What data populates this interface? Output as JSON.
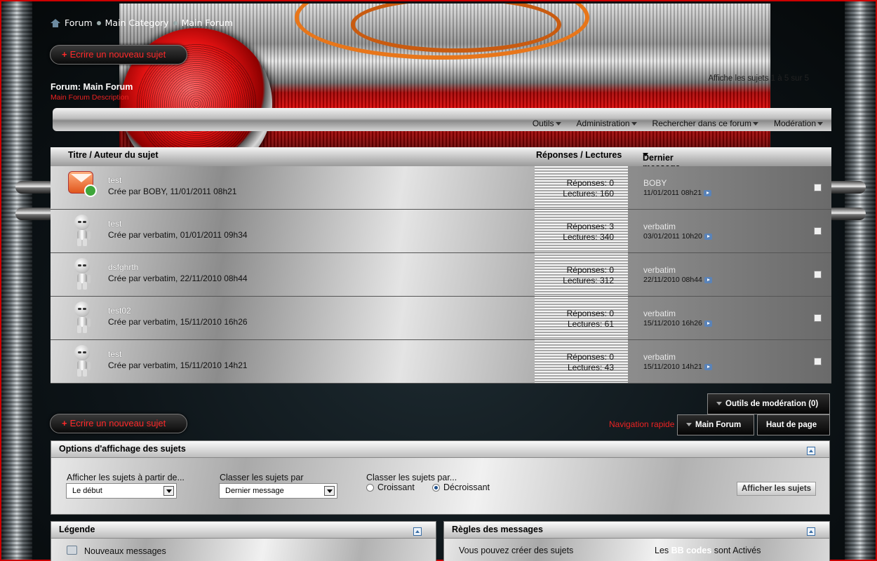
{
  "breadcrumb": {
    "items": [
      "Forum",
      "Main Category",
      "Main Forum"
    ]
  },
  "new_topic_label": "Ecrire un nouveau sujet",
  "forum": {
    "title": "Forum: Main Forum",
    "description": "Main Forum Description",
    "showing_text": "Affiche les sujets 1 à 5 sur 5"
  },
  "toolbar": {
    "items": [
      "Outils",
      "Administration",
      "Rechercher dans ce forum",
      "Modération"
    ]
  },
  "table": {
    "col_title": "Titre / Auteur du sujet",
    "col_stats": "Réponses / Lectures",
    "col_last": "Dernier message"
  },
  "threads": [
    {
      "title": "test",
      "meta": "Crée par BOBY, 11/01/2011 08h21",
      "replies": "Réponses: 0",
      "views": "Lectures: 160",
      "last_user": "BOBY",
      "last_date": "11/01/2011 08h21",
      "icon": "new-mail-icon"
    },
    {
      "title": "test",
      "meta": "Crée par verbatim, 01/01/2011 09h34",
      "replies": "Réponses: 3",
      "views": "Lectures: 340",
      "last_user": "verbatim",
      "last_date": "03/01/2011 10h20",
      "icon": "robot-avatar"
    },
    {
      "title": "dsfghrth",
      "meta": "Crée par verbatim, 22/11/2010 08h44",
      "replies": "Réponses: 0",
      "views": "Lectures: 312",
      "last_user": "verbatim",
      "last_date": "22/11/2010 08h44",
      "icon": "robot-avatar"
    },
    {
      "title": "test02",
      "meta": "Crée par verbatim, 15/11/2010 16h26",
      "replies": "Réponses: 0",
      "views": "Lectures: 61",
      "last_user": "verbatim",
      "last_date": "15/11/2010 16h26",
      "icon": "robot-avatar"
    },
    {
      "title": "test",
      "meta": "Crée par verbatim, 15/11/2010 14h21",
      "replies": "Réponses: 0",
      "views": "Lectures: 43",
      "last_user": "verbatim",
      "last_date": "15/11/2010 14h21",
      "icon": "robot-avatar"
    }
  ],
  "moderation_tools": "Outils de modération (0)",
  "nav": {
    "label": "Navigation rapide",
    "main_forum": "Main Forum",
    "top_of_page": "Haut de page"
  },
  "display_options": {
    "title": "Options d'affichage des sujets",
    "from_label": "Afficher les sujets à partir de...",
    "from_value": "Le début",
    "sort_label": "Classer les sujets par",
    "sort_value": "Dernier message",
    "order_label": "Classer les sujets par...",
    "asc": "Croissant",
    "desc": "Décroissant",
    "submit": "Afficher les sujets"
  },
  "legend": {
    "title": "Légende",
    "new_messages": "Nouveaux messages"
  },
  "rules": {
    "title": "Règles des messages",
    "line1": "Vous pouvez créer des sujets",
    "bb_prefix": "Les",
    "bb_codes": "BB codes",
    "bb_suffix": "sont Activés"
  },
  "colors": {
    "accent_red": "#ff2a2a",
    "border_red": "#cc0000"
  }
}
